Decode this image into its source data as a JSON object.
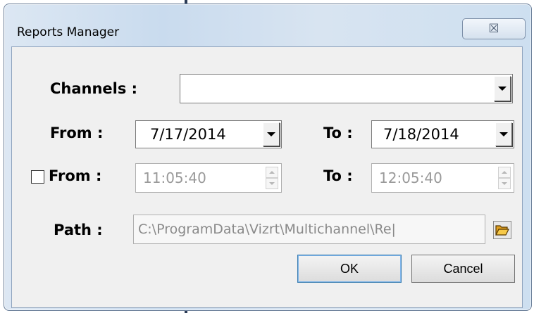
{
  "window": {
    "title": "Reports Manager",
    "close_glyph": "☒"
  },
  "form": {
    "channels_label": "Channels :",
    "channels_value": "",
    "date_from_label": "From :",
    "date_from_value": "7/17/2014",
    "date_to_label": "To :",
    "date_to_value": "7/18/2014",
    "time_enabled": false,
    "time_from_label": "From :",
    "time_from_value": "11:05:40",
    "time_to_label": "To :",
    "time_to_value": "12:05:40",
    "path_label": "Path :",
    "path_value": "C:\\ProgramData\\Vizrt\\Multichannel\\Re|"
  },
  "buttons": {
    "ok_label": "OK",
    "cancel_label": "Cancel"
  },
  "icons": {
    "close": "close-icon",
    "dropdown": "chevron-down-icon",
    "spin_up": "spin-up-icon",
    "spin_down": "spin-down-icon",
    "browse": "folder-open-icon"
  }
}
